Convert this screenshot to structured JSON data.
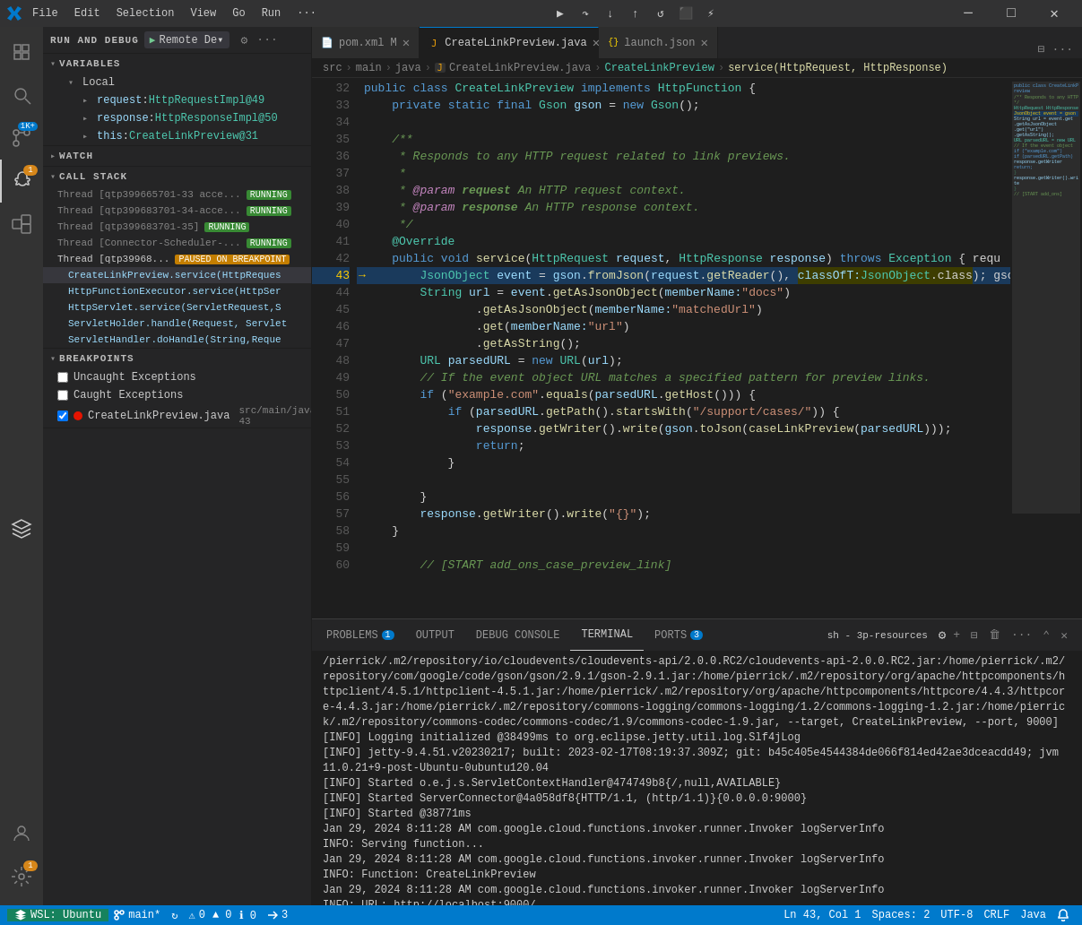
{
  "titlebar": {
    "menus": [
      "File",
      "Edit",
      "Selection",
      "View",
      "Go",
      "Run",
      "···"
    ],
    "window_controls": [
      "minimize",
      "maximize",
      "close"
    ]
  },
  "debug_toolbar": {
    "play_label": "▶",
    "config_name": "Remote De▾"
  },
  "sidebar": {
    "run_debug_label": "RUN AND DEBUG",
    "sections": {
      "variables": {
        "title": "VARIABLES",
        "local": {
          "title": "Local",
          "items": [
            {
              "name": "request",
              "type": "HttpRequestImpl@49"
            },
            {
              "name": "response",
              "type": "HttpResponseImpl@50"
            },
            {
              "name": "this",
              "type": "CreateLinkPreview@31"
            }
          ]
        }
      },
      "watch": {
        "title": "WATCH"
      },
      "call_stack": {
        "title": "CALL STACK",
        "threads": [
          {
            "name": "Thread [qtp399665701-33 acce...",
            "status": "RUNNING"
          },
          {
            "name": "Thread [qtp399683701-34-acce...",
            "status": "RUNNING"
          },
          {
            "name": "Thread [qtp399683701-35]",
            "status": "RUNNING"
          },
          {
            "name": "Thread [Connector-Scheduler-...",
            "status": "RUNNING"
          },
          {
            "name": "Thread [qtp39968...",
            "status": "PAUSED ON BREAKPOINT"
          }
        ],
        "frames": [
          {
            "method": "CreateLinkPreview.service(HttpReques",
            "file": ""
          },
          {
            "method": "HttpFunctionExecutor.service(HttpSer",
            "file": ""
          },
          {
            "method": "HttpServlet.service(ServletRequest,S",
            "file": ""
          },
          {
            "method": "ServletHolder.handle(Request, Servlet",
            "file": ""
          },
          {
            "method": "ServletHandler.doHandle(String,Reque",
            "file": ""
          }
        ]
      },
      "breakpoints": {
        "title": "BREAKPOINTS",
        "items": [
          {
            "label": "Uncaught Exceptions",
            "checked": false,
            "has_dot": false
          },
          {
            "label": "Caught Exceptions",
            "checked": false,
            "has_dot": false
          },
          {
            "label": "CreateLinkPreview.java",
            "location": "src/main/java 43",
            "checked": true,
            "has_dot": true
          }
        ]
      }
    }
  },
  "editor": {
    "tabs": [
      {
        "name": "pom.xml",
        "icon": "📄",
        "modified": true,
        "active": false
      },
      {
        "name": "CreateLinkPreview.java",
        "icon": "J",
        "modified": false,
        "active": true
      },
      {
        "name": "launch.json",
        "icon": "{}",
        "modified": false,
        "active": false
      }
    ],
    "breadcrumb": [
      "src",
      "main",
      "java",
      "CreateLinkPreview.java",
      "CreateLinkPreview",
      "service(HttpRequest, HttpResponse)"
    ],
    "lines": [
      {
        "num": "32",
        "content": "public class CreateLinkPreview implements HttpFunction {",
        "tokens": [
          {
            "t": "kw",
            "v": "public"
          },
          {
            "t": "plain",
            "v": " "
          },
          {
            "t": "kw",
            "v": "class"
          },
          {
            "t": "plain",
            "v": " "
          },
          {
            "t": "type",
            "v": "CreateLinkPreview"
          },
          {
            "t": "plain",
            "v": " "
          },
          {
            "t": "kw",
            "v": "implements"
          },
          {
            "t": "plain",
            "v": " "
          },
          {
            "t": "type",
            "v": "HttpFunction"
          },
          {
            "t": "plain",
            "v": " {"
          }
        ]
      },
      {
        "num": "33",
        "content": "    private static final Gson gson = new Gson();",
        "tokens": [
          {
            "t": "plain",
            "v": "    "
          },
          {
            "t": "kw",
            "v": "private"
          },
          {
            "t": "plain",
            "v": " "
          },
          {
            "t": "kw",
            "v": "static"
          },
          {
            "t": "plain",
            "v": " "
          },
          {
            "t": "kw",
            "v": "final"
          },
          {
            "t": "plain",
            "v": " "
          },
          {
            "t": "type",
            "v": "Gson"
          },
          {
            "t": "plain",
            "v": " "
          },
          {
            "t": "var-c",
            "v": "gson"
          },
          {
            "t": "plain",
            "v": " = "
          },
          {
            "t": "kw",
            "v": "new"
          },
          {
            "t": "plain",
            "v": " "
          },
          {
            "t": "type",
            "v": "Gson"
          },
          {
            "t": "plain",
            "v": "();"
          }
        ]
      },
      {
        "num": "34",
        "content": ""
      },
      {
        "num": "35",
        "content": "    /**",
        "tokens": [
          {
            "t": "comment",
            "v": "    /**"
          }
        ]
      },
      {
        "num": "36",
        "content": "     * Responds to any HTTP request related to link previews.",
        "tokens": [
          {
            "t": "comment",
            "v": "     * Responds to any HTTP request related to link previews."
          }
        ]
      },
      {
        "num": "37",
        "content": "     *",
        "tokens": [
          {
            "t": "comment",
            "v": "     *"
          }
        ]
      },
      {
        "num": "38",
        "content": "     * @param request An HTTP request context.",
        "tokens": [
          {
            "t": "comment",
            "v": "     * @param request An HTTP request context."
          }
        ]
      },
      {
        "num": "39",
        "content": "     * @param response An HTTP response context.",
        "tokens": [
          {
            "t": "comment",
            "v": "     * @param response An HTTP response context."
          }
        ]
      },
      {
        "num": "40",
        "content": "     */",
        "tokens": [
          {
            "t": "comment",
            "v": "     */"
          }
        ]
      },
      {
        "num": "41",
        "content": "    @Override",
        "tokens": [
          {
            "t": "ann",
            "v": "    @Override"
          }
        ]
      },
      {
        "num": "42",
        "content": "    public void service(HttpRequest request, HttpResponse response) throws Exception { requ",
        "tokens": [
          {
            "t": "plain",
            "v": "    "
          },
          {
            "t": "kw",
            "v": "public"
          },
          {
            "t": "plain",
            "v": " "
          },
          {
            "t": "kw",
            "v": "void"
          },
          {
            "t": "plain",
            "v": " "
          },
          {
            "t": "fn",
            "v": "service"
          },
          {
            "t": "plain",
            "v": "("
          },
          {
            "t": "type",
            "v": "HttpRequest"
          },
          {
            "t": "plain",
            "v": " "
          },
          {
            "t": "var-c",
            "v": "request"
          },
          {
            "t": "plain",
            "v": ", "
          },
          {
            "t": "type",
            "v": "HttpResponse"
          },
          {
            "t": "plain",
            "v": " "
          },
          {
            "t": "var-c",
            "v": "response"
          },
          {
            "t": "plain",
            "v": ") "
          },
          {
            "t": "kw",
            "v": "throws"
          },
          {
            "t": "plain",
            "v": " "
          },
          {
            "t": "type",
            "v": "Exception"
          },
          {
            "t": "plain",
            "v": " { requ"
          }
        ]
      },
      {
        "num": "43",
        "content": "        JsonObject event = gson.fromJson(request.getReader(), classOfT:JsonObject.class); gso",
        "debug_arrow": true,
        "active_debug": true
      },
      {
        "num": "44",
        "content": "        String url = event.getAsJsonObject(memberName:\"docs\")"
      },
      {
        "num": "45",
        "content": "                .getAsJsonObject(memberName:\"matchedUrl\")"
      },
      {
        "num": "46",
        "content": "                .get(memberName:\"url\")"
      },
      {
        "num": "47",
        "content": "                .getAsString();"
      },
      {
        "num": "48",
        "content": "        URL parsedURL = new URL(url);"
      },
      {
        "num": "49",
        "content": "        // If the event object URL matches a specified pattern for preview links."
      },
      {
        "num": "50",
        "content": "        if (\"example.com\".equals(parsedURL.getHost())) {"
      },
      {
        "num": "51",
        "content": "            if (parsedURL.getPath().startsWith(\"/support/cases/\")) {"
      },
      {
        "num": "52",
        "content": "                response.getWriter().write(gson.toJson(caseLinkPreview(parsedURL)));"
      },
      {
        "num": "53",
        "content": "                return;"
      },
      {
        "num": "54",
        "content": "            }"
      },
      {
        "num": "55",
        "content": ""
      },
      {
        "num": "56",
        "content": "        }"
      },
      {
        "num": "57",
        "content": "        response.getWriter().write(\"{}\");"
      },
      {
        "num": "58",
        "content": "    }"
      },
      {
        "num": "59",
        "content": ""
      },
      {
        "num": "60",
        "content": "        // [START add_ons_case_preview_link]"
      }
    ]
  },
  "bottom_panel": {
    "tabs": [
      {
        "label": "PROBLEMS",
        "badge": "1",
        "active": false
      },
      {
        "label": "OUTPUT",
        "badge": null,
        "active": false
      },
      {
        "label": "DEBUG CONSOLE",
        "badge": null,
        "active": false
      },
      {
        "label": "TERMINAL",
        "badge": null,
        "active": true
      },
      {
        "label": "PORTS",
        "badge": "3",
        "active": false
      }
    ],
    "terminal_header": "sh - 3p-resources",
    "terminal_lines": [
      "/pierrick/.m2/repository/io/cloudevents/cloudevents-api/2.0.0.RC2/cloudevents-api-2.0.0.RC2.jar:/home/pierrick/.m2/repository/com/google/code/gson/gson/2.9.1/gson-2.9.1.jar:/home/pierrick/.m2/repository/org/apache/httpcomponents/httpclient/4.5.1/httpclient-4.5.1.jar:/home/pierrick/.m2/repository/org/apache/httpcomponents/httpcore/4.4.3/httpcore-4.4.3.jar:/home/pierrick/.m2/repository/commons-logging/commons-logging/1.2/commons-logging-1.2.jar:/home/pierrick/.m2/repository/commons-codec/commons-codec/1.9/commons-codec-1.9.jar, --target, CreateLinkPreview, --port, 9000]",
      "[INFO] Logging initialized @38499ms to org.eclipse.jetty.util.log.Slf4jLog",
      "[INFO] jetty-9.4.51.v20230217; built: 2023-02-17T08:19:37.309Z; git: b45c405e4544384de066f814ed42ae3dceacdd49; jvm 11.0.21+9-post-Ubuntu-0ubuntu120.04",
      "[INFO] Started o.e.j.s.ServletContextHandler@474749b8{/,null,AVAILABLE}",
      "[INFO] Started ServerConnector@4a058df8{HTTP/1.1, (http/1.1)}{0.0.0.0:9000}",
      "[INFO] Started @38771ms",
      "Jan 29, 2024 8:11:28 AM com.google.cloud.functions.invoker.runner.Invoker logServerInfo",
      "INFO: Serving function...",
      "Jan 29, 2024 8:11:28 AM com.google.cloud.functions.invoker.runner.Invoker logServerInfo",
      "INFO: Function: CreateLinkPreview",
      "Jan 29, 2024 8:11:28 AM com.google.cloud.functions.invoker.runner.Invoker logServerInfo",
      "INFO: URL: http://localhost:9000/"
    ]
  },
  "status_bar": {
    "remote": "WSL: Ubuntu",
    "branch": "main*",
    "sync": "↻",
    "errors": "0",
    "warnings": "0",
    "info": "0",
    "port_forward": "3",
    "position": "Ln 43, Col 1",
    "spaces": "Spaces: 2",
    "encoding": "UTF-8",
    "line_ending": "CRLF",
    "language": "Java",
    "notifications": "🔔"
  }
}
